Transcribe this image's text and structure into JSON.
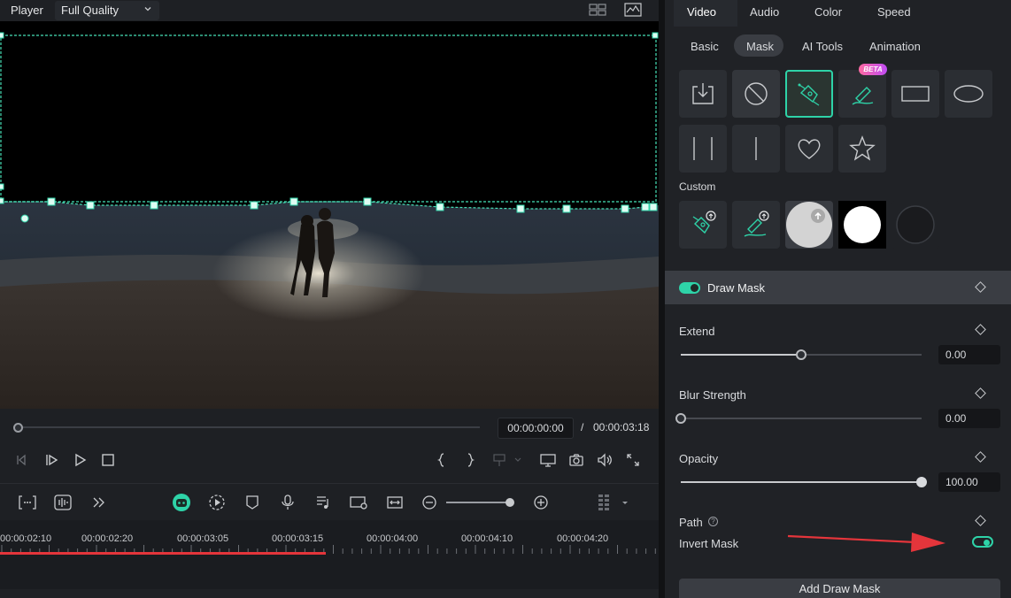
{
  "player": {
    "label": "Player",
    "quality": "Full Quality",
    "current_time": "00:00:00:00",
    "separator": "/",
    "total_time": "00:00:03:18"
  },
  "timeline": {
    "ruler_labels": [
      "00:00:02:10",
      "00:00:02:20",
      "00:00:03:05",
      "00:00:03:15",
      "00:00:04:00",
      "00:00:04:10",
      "00:00:04:20"
    ]
  },
  "panel": {
    "main_tabs": [
      "Video",
      "Audio",
      "Color",
      "Speed"
    ],
    "sub_tabs": [
      "Basic",
      "Mask",
      "AI Tools",
      "Animation"
    ],
    "beta_badge": "BETA",
    "custom_label": "Custom",
    "draw_mask_label": "Draw Mask",
    "extend_label": "Extend",
    "extend_value": "0.00",
    "blur_label": "Blur Strength",
    "blur_value": "0.00",
    "opacity_label": "Opacity",
    "opacity_value": "100.00",
    "path_label": "Path",
    "help_glyph": "?",
    "invert_label": "Invert Mask",
    "add_button": "Add Draw Mask"
  },
  "sliders": {
    "extend_fraction": 0.5,
    "blur_fraction": 0.0,
    "opacity_fraction": 1.0
  },
  "toggles": {
    "draw_mask_on": true,
    "invert_mask_on": true
  },
  "colors": {
    "accent": "#2ed3a8",
    "annotation_arrow": "#e4353b",
    "playhead_progress": "#e4353b"
  },
  "icons": [
    "chevron-down-icon",
    "grid-view-icon",
    "waveform-icon",
    "previous-frame-icon",
    "play-step-icon",
    "play-icon",
    "stop-icon",
    "mark-in-icon",
    "mark-out-icon",
    "monitor-icon",
    "snapshot-icon",
    "volume-icon",
    "fullscreen-icon",
    "import-mask-icon",
    "no-mask-icon",
    "pen-tool-icon",
    "ai-brush-icon",
    "rectangle-mask-icon",
    "ellipse-mask-icon",
    "double-line-icon",
    "single-line-icon",
    "heart-icon",
    "star-icon",
    "diamond-keyframe-icon"
  ]
}
